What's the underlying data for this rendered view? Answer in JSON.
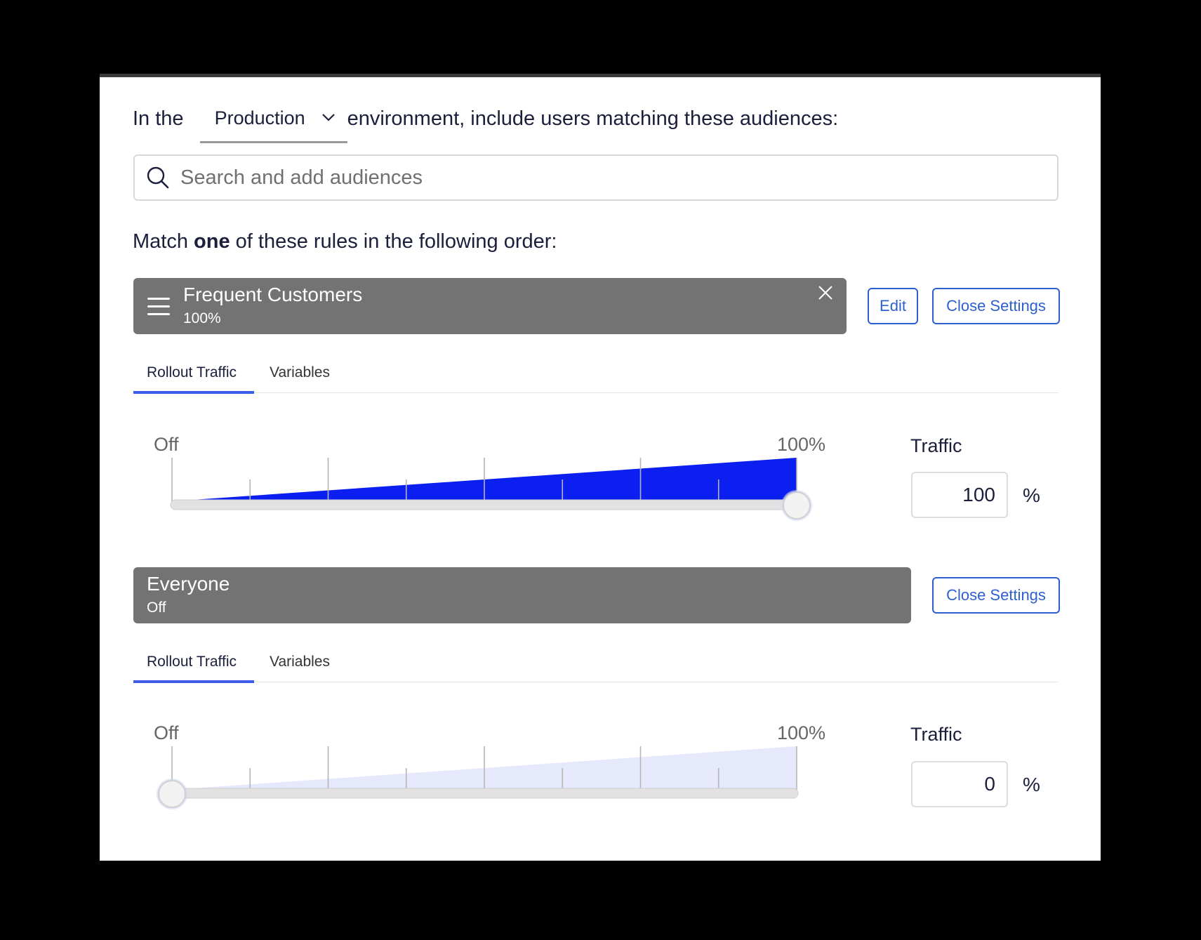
{
  "environment": {
    "prefix": "In the",
    "selected": "Production",
    "suffix": "environment, include users matching these audiences:"
  },
  "search": {
    "placeholder": "Search and add audiences"
  },
  "match": {
    "pre": "Match ",
    "bold": "one",
    "post": " of these rules in the following order:"
  },
  "rules": [
    {
      "name": "Frequent Customers",
      "status": "100%",
      "edit_label": "Edit",
      "close_label": "Close Settings",
      "tabs": [
        "Rollout Traffic",
        "Variables"
      ],
      "slider": {
        "min_label": "Off",
        "max_label": "100%",
        "value": 100,
        "fill_color": "#0a1ff0"
      },
      "traffic_label": "Traffic",
      "traffic_value": "100",
      "unit": "%"
    },
    {
      "name": "Everyone",
      "status": "Off",
      "close_label": "Close Settings",
      "tabs": [
        "Rollout Traffic",
        "Variables"
      ],
      "slider": {
        "min_label": "Off",
        "max_label": "100%",
        "value": 0,
        "fill_color": "#e6e8fb"
      },
      "traffic_label": "Traffic",
      "traffic_value": "0",
      "unit": "%"
    }
  ],
  "colors": {
    "accent": "#2d5fd0",
    "tab_underline": "#3d5ee8",
    "rule_bar": "#737373"
  },
  "icons": {
    "search": "search-icon",
    "dropdown": "chevron-down-icon",
    "drag": "drag-handle-icon",
    "remove": "close-icon"
  }
}
